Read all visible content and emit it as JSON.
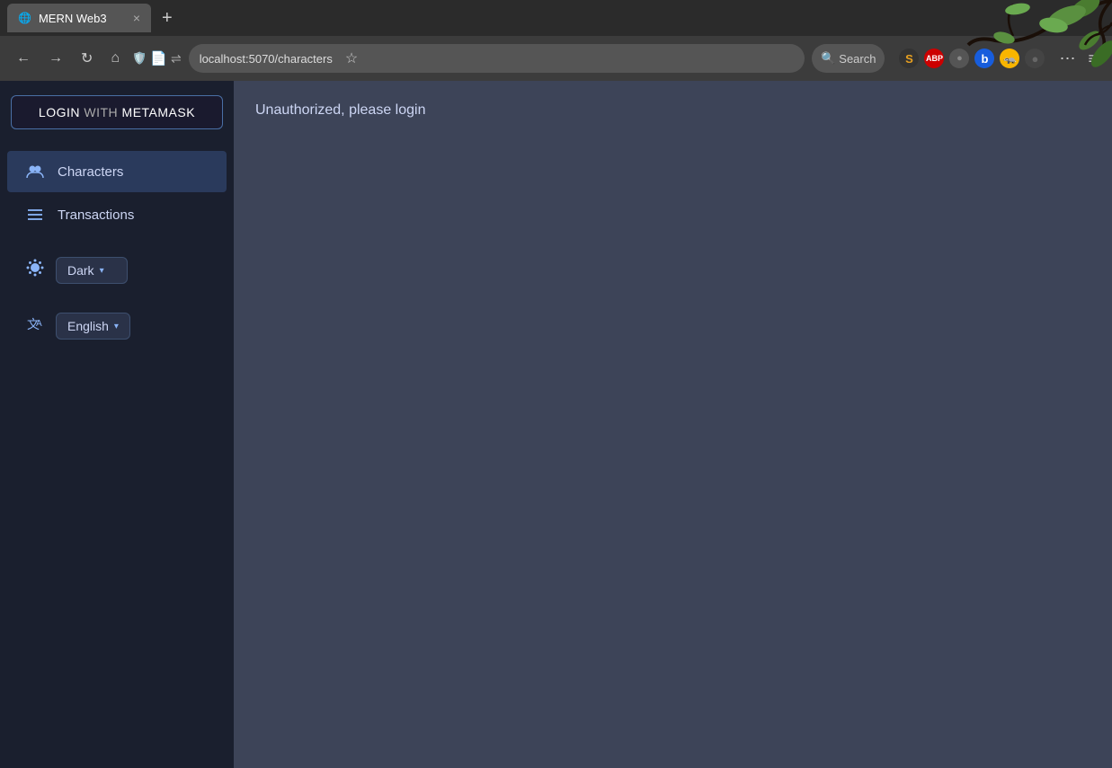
{
  "browser": {
    "tab_title": "MERN Web3",
    "tab_close": "×",
    "new_tab_icon": "+",
    "address": "localhost:5070/characters",
    "search_placeholder": "Search",
    "back_icon": "←",
    "forward_icon": "→",
    "reload_icon": "↻",
    "home_icon": "⌂",
    "extensions": [
      {
        "name": "scribd",
        "label": "S",
        "bg": "#333",
        "color": "#e8a020"
      },
      {
        "name": "adblock",
        "label": "ABP",
        "bg": "#cc0000",
        "color": "#fff"
      },
      {
        "name": "circle",
        "label": "●",
        "bg": "#444",
        "color": "#888"
      },
      {
        "name": "bitwarden",
        "label": "b",
        "bg": "#175DDC",
        "color": "#fff"
      },
      {
        "name": "privacy-badger",
        "label": "🦡",
        "bg": "#f8b500",
        "color": "#fff"
      },
      {
        "name": "ext6",
        "label": "●",
        "bg": "#444",
        "color": "#888"
      }
    ],
    "more_btn": "⋯",
    "menu_btn": "≡"
  },
  "sidebar": {
    "login_btn": {
      "login": "LOGIN",
      "with": "WITH",
      "metamask": "METAMASK"
    },
    "nav_items": [
      {
        "id": "characters",
        "label": "Characters",
        "icon": "👥",
        "active": true
      },
      {
        "id": "transactions",
        "label": "Transactions",
        "icon": "☰",
        "active": false
      }
    ],
    "theme": {
      "icon": "🎨",
      "label": "Dark",
      "arrow": "▾"
    },
    "language": {
      "icon": "文A",
      "label": "English",
      "arrow": "▾"
    }
  },
  "main": {
    "unauthorized_message": "Unauthorized, please login"
  }
}
